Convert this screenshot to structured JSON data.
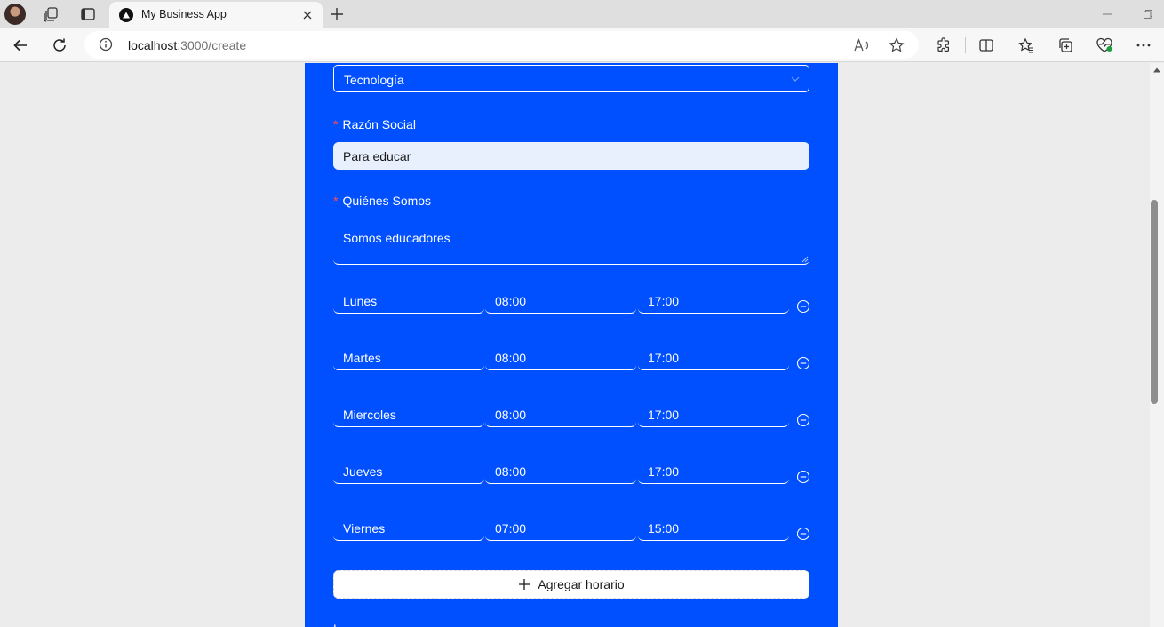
{
  "browser": {
    "tab": {
      "title": "My Business App"
    },
    "address": {
      "host": "localhost",
      "path": ":3000/create"
    }
  },
  "form": {
    "category": {
      "value": "Tecnología"
    },
    "razon_social": {
      "label": "Razón Social",
      "required_mark": "*",
      "value": "Para educar"
    },
    "quienes_somos": {
      "label": "Quiénes Somos",
      "required_mark": "*",
      "value": "Somos educadores"
    },
    "schedule": [
      {
        "day": "Lunes",
        "open": "08:00",
        "close": "17:00"
      },
      {
        "day": "Martes",
        "open": "08:00",
        "close": "17:00"
      },
      {
        "day": "Miercoles",
        "open": "08:00",
        "close": "17:00"
      },
      {
        "day": "Jueves",
        "open": "08:00",
        "close": "17:00"
      },
      {
        "day": "Viernes",
        "open": "07:00",
        "close": "15:00"
      }
    ],
    "add_schedule_label": "Agregar horario",
    "next_label_partial": "L"
  },
  "colors": {
    "panel": "#0050ff",
    "required": "#ff4d4f",
    "input_fill": "#e8f0fe"
  },
  "icons": [
    "profile-avatar",
    "workspaces-icon",
    "tab-actions-icon",
    "app-favicon",
    "close-icon",
    "plus-icon",
    "back-icon",
    "refresh-icon",
    "info-icon",
    "read-aloud-icon",
    "favorite-star-icon",
    "extensions-icon",
    "split-screen-icon",
    "favorites-icon",
    "collections-icon",
    "performance-icon",
    "more-icon",
    "chevron-down-icon",
    "minus-circle-icon"
  ]
}
